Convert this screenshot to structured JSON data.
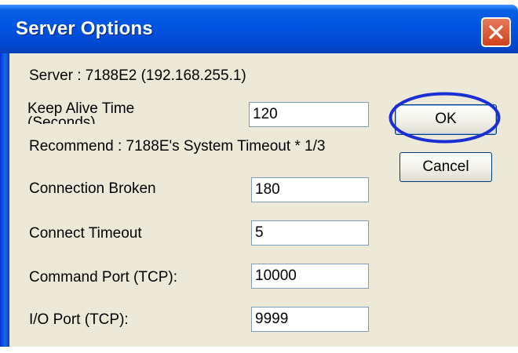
{
  "window": {
    "title": "Server Options"
  },
  "server": {
    "text": "Server :   7188E2 (192.168.255.1)"
  },
  "keep_alive": {
    "label_line1": "Keep Alive Time",
    "label_line2": "(Seconds)",
    "value": "120",
    "recommend": "Recommend : 7188E's System Timeout * 1/3"
  },
  "fields": {
    "connection_broken": {
      "label": "Connection Broken",
      "value": "180"
    },
    "connect_timeout": {
      "label": "Connect Timeout",
      "value": "5"
    },
    "command_port": {
      "label": "Command Port (TCP):",
      "value": "10000"
    },
    "io_port": {
      "label": "I/O Port (TCP):",
      "value": "9999"
    }
  },
  "buttons": {
    "ok": "OK",
    "cancel": "Cancel"
  },
  "icons": {
    "close": "close-icon"
  },
  "colors": {
    "titlebar": "#0054e3",
    "close": "#d1421c",
    "highlight": "#1a2ed6",
    "dialog_bg": "#ece9d8"
  }
}
